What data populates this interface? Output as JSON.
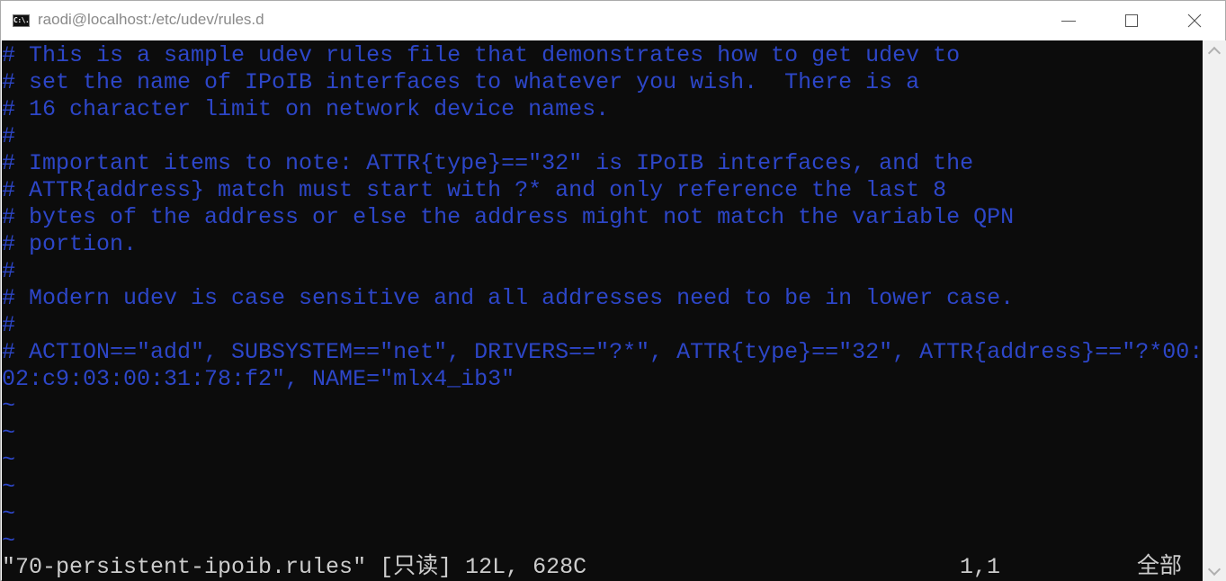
{
  "window": {
    "title": "raodi@localhost:/etc/udev/rules.d",
    "app_icon_text": "C:\\.",
    "controls": {
      "minimize": "minimize-icon",
      "maximize": "maximize-icon",
      "close": "close-icon",
      "close_glyph": "✕"
    }
  },
  "editor": {
    "lines": [
      "# This is a sample udev rules file that demonstrates how to get udev to",
      "# set the name of IPoIB interfaces to whatever you wish.  There is a",
      "# 16 character limit on network device names.",
      "#",
      "# Important items to note: ATTR{type}==\"32\" is IPoIB interfaces, and the",
      "# ATTR{address} match must start with ?* and only reference the last 8",
      "# bytes of the address or else the address might not match the variable QPN",
      "# portion.",
      "#",
      "# Modern udev is case sensitive and all addresses need to be in lower case.",
      "#",
      "# ACTION==\"add\", SUBSYSTEM==\"net\", DRIVERS==\"?*\", ATTR{type}==\"32\", ATTR{address}==\"?*00:",
      "02:c9:03:00:31:78:f2\", NAME=\"mlx4_ib3\""
    ],
    "empty_line_marker": "~",
    "empty_lines_count": 6,
    "colors": {
      "comment": "#2d46c8",
      "background": "#0c0c0c",
      "status_text": "#cccccc"
    }
  },
  "statusline": {
    "file_info": "\"70-persistent-ipoib.rules\" [只读] 12L, 628C",
    "cursor_position": "1,1",
    "scroll_position": "全部"
  },
  "scrollbar": {
    "up": "chevron-up-icon",
    "down": "chevron-down-icon"
  }
}
